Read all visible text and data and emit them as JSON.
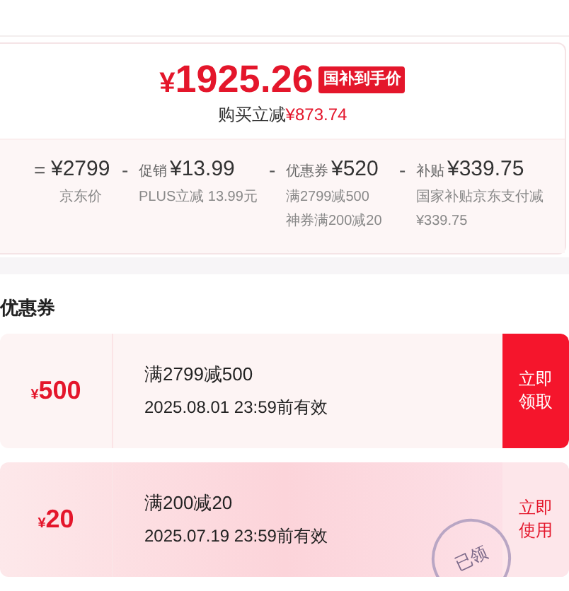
{
  "price": {
    "currency": "¥",
    "amount": "1925.26",
    "badge": "国补到手价",
    "saving_label": "购买立减",
    "saving": "¥873.74"
  },
  "breakdown": [
    {
      "op": "=",
      "value": "¥2799",
      "notes": [
        "京东价"
      ]
    },
    {
      "op": "-",
      "label": "促销",
      "value": "¥13.99",
      "notes": [
        "PLUS立减 13.99元"
      ]
    },
    {
      "op": "-",
      "label": "优惠券",
      "value": "¥520",
      "notes": [
        "满2799减500",
        "神券满200减20"
      ]
    },
    {
      "op": "-",
      "label": "补贴",
      "value": "¥339.75",
      "notes": [
        "国家补贴京东支付减¥339.75"
      ]
    }
  ],
  "coupons": {
    "title": "优惠券",
    "items": [
      {
        "currency": "¥",
        "amount": "500",
        "condition": "满2799减500",
        "validity": "2025.08.01 23:59前有效",
        "action": "立即领取",
        "claimed": false
      },
      {
        "currency": "¥",
        "amount": "20",
        "condition": "满200减20",
        "validity": "2025.07.19 23:59前有效",
        "action": "立即使用",
        "claimed": true,
        "stamp": "已领"
      }
    ]
  }
}
